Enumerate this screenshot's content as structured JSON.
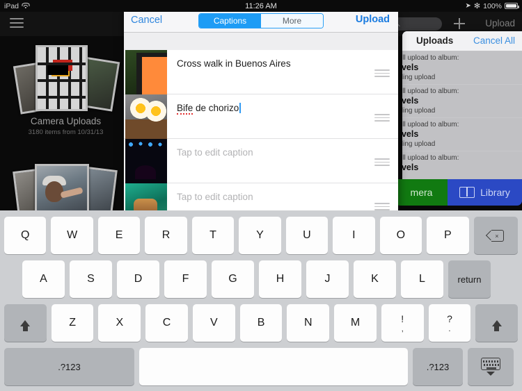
{
  "status_bar": {
    "device": "iPad",
    "wifi_icon": "wifi-icon",
    "time": "11:26 AM",
    "location_icon": "location-arrow-icon",
    "bluetooth_icon": "bluetooth-icon",
    "battery_percent": "100%",
    "battery_icon": "battery-full-icon"
  },
  "background_app": {
    "menu_icon": "hamburger-menu-icon",
    "search_icon": "search-icon",
    "search_placeholder": "",
    "add_icon": "plus-icon",
    "upload_label": "Upload",
    "albums": [
      {
        "title": "Camera Uploads",
        "subtitle": "3180 items from 10/31/13"
      }
    ]
  },
  "uploads_popover": {
    "title": "Uploads",
    "cancel_all_label": "Cancel All",
    "rows": [
      {
        "line1": "ill upload to album:",
        "line2": "avels",
        "line3": "nding upload"
      },
      {
        "line1": "ill upload to album:",
        "line2": "avels",
        "line3": "nding upload"
      },
      {
        "line1": "ill upload to album:",
        "line2": "avels",
        "line3": "nding upload"
      },
      {
        "line1": "ill upload to album:",
        "line2": "avels",
        "line3": ""
      }
    ],
    "camera_button": "mera",
    "library_button": "Library",
    "library_icon": "book-icon"
  },
  "caption_popover": {
    "cancel_label": "Cancel",
    "upload_label": "Upload",
    "segments": [
      {
        "label": "Captions",
        "selected": true
      },
      {
        "label": "More",
        "selected": false
      }
    ],
    "rows": [
      {
        "caption": "Cross walk in Buenos Aires",
        "placeholder": false,
        "thumb": "crosswalk-signal-photo",
        "grip_icon": "reorder-grip-icon"
      },
      {
        "caption": "Bife de chorizo",
        "placeholder": false,
        "editing": true,
        "misspelled_word": "Bife",
        "thumb": "steak-eggs-photo",
        "grip_icon": "reorder-grip-icon"
      },
      {
        "caption": "Tap to edit caption",
        "placeholder": true,
        "thumb": "concert-stage-photo",
        "grip_icon": "reorder-grip-icon"
      },
      {
        "caption": "Tap to edit caption",
        "placeholder": true,
        "thumb": "performer-photo",
        "grip_icon": "reorder-grip-icon"
      }
    ]
  },
  "keyboard": {
    "row1": [
      "Q",
      "W",
      "E",
      "R",
      "T",
      "Y",
      "U",
      "I",
      "O",
      "P"
    ],
    "backspace_icon": "backspace-icon",
    "row2": [
      "A",
      "S",
      "D",
      "F",
      "G",
      "H",
      "J",
      "K",
      "L"
    ],
    "return_label": "return",
    "row3": [
      "Z",
      "X",
      "C",
      "V",
      "B",
      "N",
      "M"
    ],
    "punct_keys": [
      {
        "up": "!",
        "down": ","
      },
      {
        "up": "?",
        "down": "."
      }
    ],
    "shift_icon": "shift-arrow-icon",
    "numeric_left_label": ".?123",
    "numeric_right_label": ".?123",
    "space_label": "",
    "hide_keyboard_icon": "hide-keyboard-icon"
  },
  "colors": {
    "accent_blue": "#1e9cf5",
    "link_blue": "#2f86dd",
    "camera_green": "#117a11",
    "library_blue": "#2b49c4",
    "keyboard_bg": "#cdcfd2",
    "spellcheck_red": "#e03030"
  }
}
